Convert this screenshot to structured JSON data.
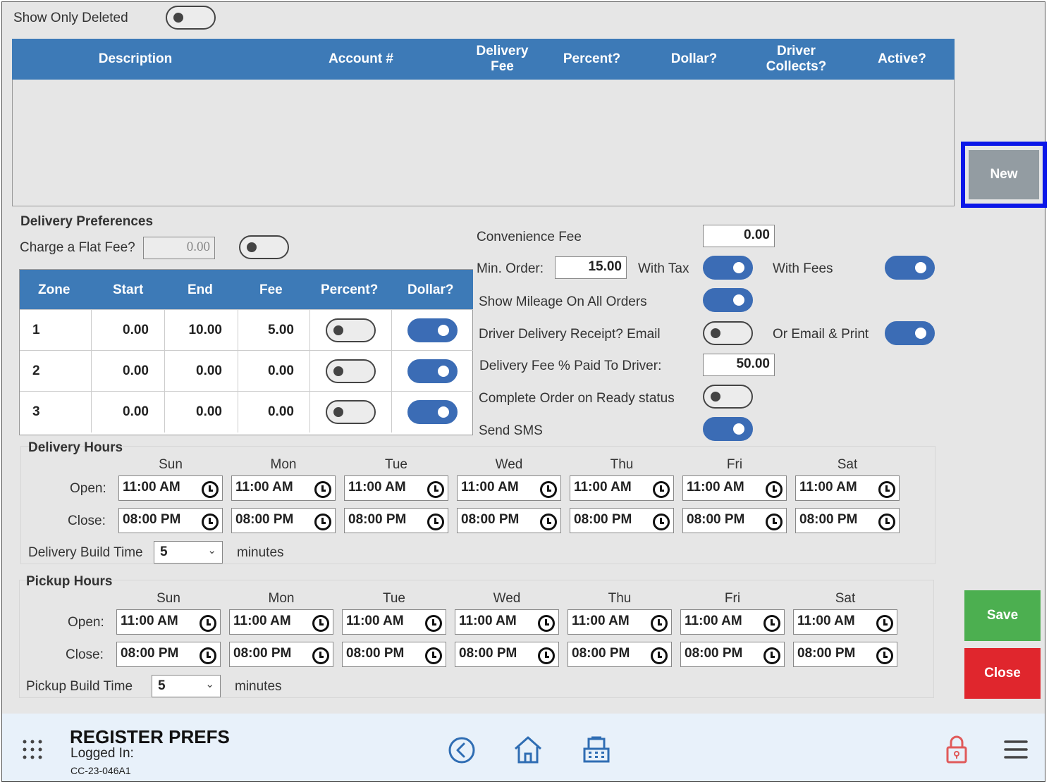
{
  "filter": {
    "show_only_deleted_label": "Show Only Deleted",
    "show_only_deleted": false
  },
  "main_table": {
    "columns": [
      "Description",
      "Account #",
      "Delivery Fee",
      "Percent?",
      "Dollar?",
      "Driver Collects?",
      "Active?"
    ],
    "rows": []
  },
  "actions": {
    "new_label": "New",
    "save_label": "Save",
    "close_label": "Close"
  },
  "colors": {
    "header": "#3d7ab7",
    "toggle_on": "#3b6cb5",
    "save": "#4caf50",
    "close": "#e0262d",
    "new": "#939ca2",
    "highlight": "#0b17e8"
  },
  "delivery_prefs": {
    "title": "Delivery Preferences",
    "flat_fee_label": "Charge a Flat Fee?",
    "flat_fee_value": "0.00",
    "flat_fee_enabled": false,
    "zone_columns": [
      "Zone",
      "Start",
      "End",
      "Fee",
      "Percent?",
      "Dollar?"
    ],
    "zones": [
      {
        "zone": "1",
        "start": "0.00",
        "end": "10.00",
        "fee": "5.00",
        "percent": false,
        "dollar": true
      },
      {
        "zone": "2",
        "start": "0.00",
        "end": "0.00",
        "fee": "0.00",
        "percent": false,
        "dollar": true
      },
      {
        "zone": "3",
        "start": "0.00",
        "end": "0.00",
        "fee": "0.00",
        "percent": false,
        "dollar": true
      }
    ]
  },
  "settings": {
    "convenience_fee_label": "Convenience Fee",
    "convenience_fee_value": "0.00",
    "min_order_label": "Min. Order:",
    "min_order_value": "15.00",
    "with_tax_label": "With Tax",
    "with_tax": true,
    "with_fees_label": "With Fees",
    "with_fees": true,
    "show_mileage_label": "Show Mileage On All Orders",
    "show_mileage": true,
    "driver_receipt_label": "Driver Delivery Receipt? Email",
    "driver_receipt_email": false,
    "or_email_print_label": "Or Email & Print",
    "or_email_print": true,
    "fee_pct_driver_label": "Delivery Fee % Paid To Driver:",
    "fee_pct_driver_value": "50.00",
    "complete_on_ready_label": "Complete Order on Ready status",
    "complete_on_ready": false,
    "send_sms_label": "Send SMS",
    "send_sms": true
  },
  "delivery_hours": {
    "title": "Delivery Hours",
    "open_label": "Open:",
    "close_label": "Close:",
    "days": [
      "Sun",
      "Mon",
      "Tue",
      "Wed",
      "Thu",
      "Fri",
      "Sat"
    ],
    "open": [
      "11:00 AM",
      "11:00 AM",
      "11:00 AM",
      "11:00 AM",
      "11:00 AM",
      "11:00 AM",
      "11:00 AM"
    ],
    "close": [
      "08:00 PM",
      "08:00 PM",
      "08:00 PM",
      "08:00 PM",
      "08:00 PM",
      "08:00 PM",
      "08:00 PM"
    ],
    "build_time_label": "Delivery Build Time",
    "build_time_value": "5",
    "minutes_label": "minutes"
  },
  "pickup_hours": {
    "title": "Pickup Hours",
    "open_label": "Open:",
    "close_label": "Close:",
    "days": [
      "Sun",
      "Mon",
      "Tue",
      "Wed",
      "Thu",
      "Fri",
      "Sat"
    ],
    "open": [
      "11:00 AM",
      "11:00 AM",
      "11:00 AM",
      "11:00 AM",
      "11:00 AM",
      "11:00 AM",
      "11:00 AM"
    ],
    "close": [
      "08:00 PM",
      "08:00 PM",
      "08:00 PM",
      "08:00 PM",
      "08:00 PM",
      "08:00 PM",
      "08:00 PM"
    ],
    "build_time_label": "Pickup Build Time",
    "build_time_value": "5",
    "minutes_label": "minutes"
  },
  "footer": {
    "title": "REGISTER PREFS",
    "logged_in_label": "Logged In:",
    "device_id": "CC-23-046A1",
    "icons": [
      "apps-grid-icon",
      "back-arrow-icon",
      "home-icon",
      "register-icon",
      "lock-icon",
      "menu-icon"
    ]
  }
}
